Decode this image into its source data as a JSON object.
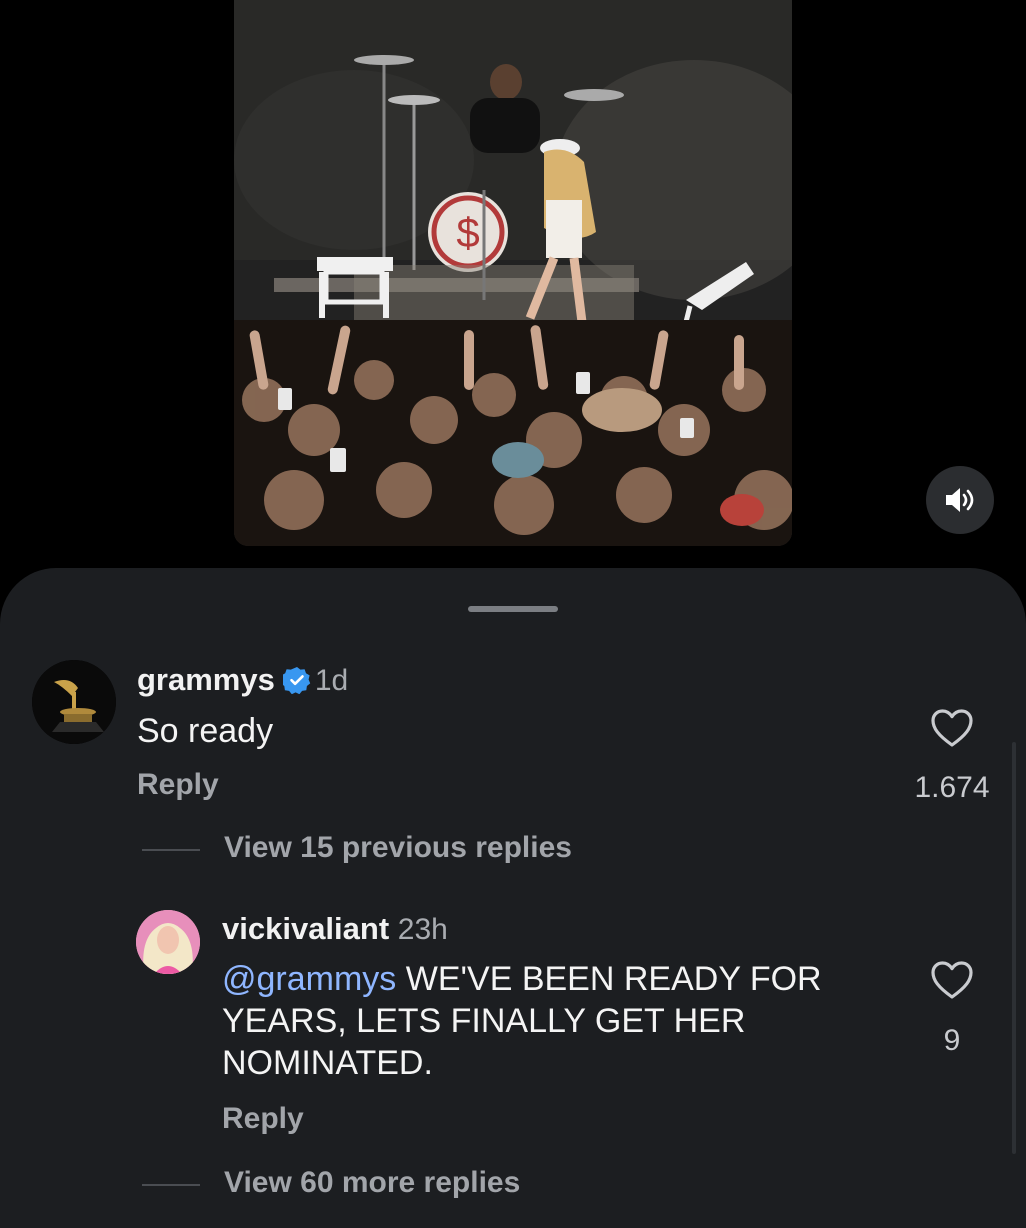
{
  "video": {
    "sound_icon": "speaker-icon"
  },
  "comments": [
    {
      "username": "grammys",
      "verified": true,
      "time": "1d",
      "text": "So ready",
      "reply_label": "Reply",
      "likes": "1.674"
    },
    {
      "view_prev_label": "View 15 previous replies"
    },
    {
      "username": "vickivaliant",
      "time": "23h",
      "mention": "@grammys",
      "text_line1": " WE'VE BEEN READY FOR",
      "text_line2": "YEARS, LETS FINALLY GET HER",
      "text_line3": "NOMINATED.",
      "reply_label": "Reply",
      "likes": "9"
    },
    {
      "view_more_label": "View 60 more replies"
    }
  ],
  "colors": {
    "sheet": "#1c1e21",
    "mention": "#8fb6ff",
    "verified": "#3897f0"
  }
}
